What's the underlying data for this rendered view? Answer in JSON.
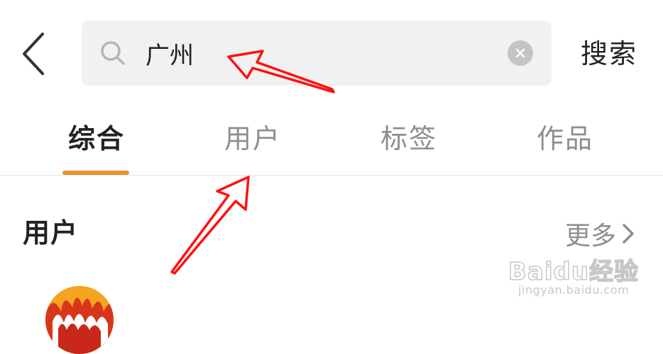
{
  "header": {
    "search_value": "广州",
    "search_button_label": "搜索"
  },
  "tabs": [
    {
      "label": "综合",
      "active": true
    },
    {
      "label": "用户",
      "active": false
    },
    {
      "label": "标签",
      "active": false
    },
    {
      "label": "作品",
      "active": false
    }
  ],
  "users_section": {
    "title": "用户",
    "more_label": "更多"
  },
  "colors": {
    "accent": "#e9932f",
    "annotation_arrow": "#ff0000",
    "search_bg": "#f1f1f1",
    "muted_text": "#8e8e8e"
  },
  "icons": {
    "back": "back-arrow-icon",
    "search": "search-icon",
    "clear": "clear-icon",
    "more": "chevron-right-icon"
  },
  "watermark": {
    "brand": "Baidu经验",
    "url": "jingyan.baidu.com"
  }
}
